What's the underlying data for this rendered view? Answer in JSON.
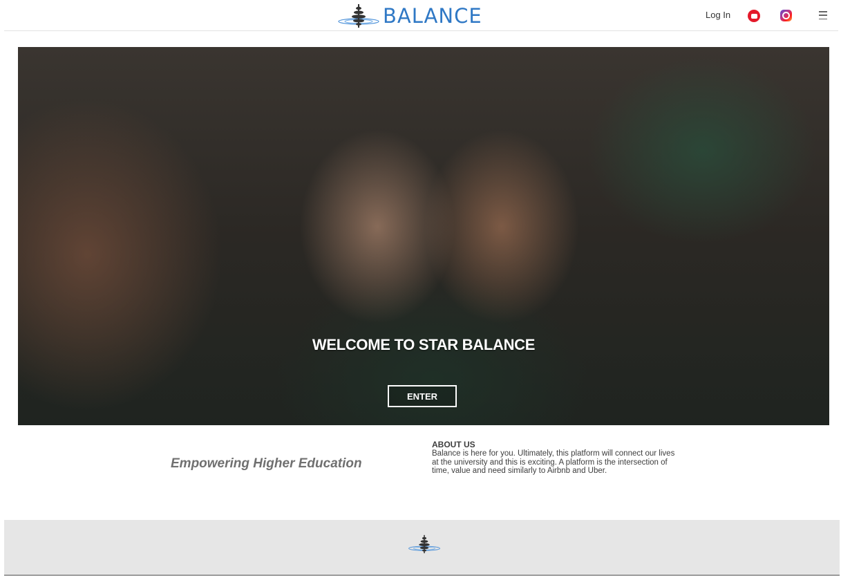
{
  "header": {
    "logo_text": "BALANCE",
    "login_label": "Log In",
    "icons": [
      "youtube-icon",
      "instagram-icon",
      "menu-icon"
    ]
  },
  "hero": {
    "title": "WELCOME TO STAR BALANCE",
    "enter_label": "ENTER"
  },
  "content": {
    "tagline": "Empowering Higher Education",
    "about_heading": "ABOUT US",
    "about_text": "Balance is here for you. Ultimately, this platform will connect our lives at the university and this is exciting. A platform is the intersection of time, value and need similarly to Airbnb and Uber."
  },
  "colors": {
    "brand_blue": "#2f78c5",
    "youtube_red": "#e4192a",
    "footer_bg": "#e6e6e6"
  }
}
